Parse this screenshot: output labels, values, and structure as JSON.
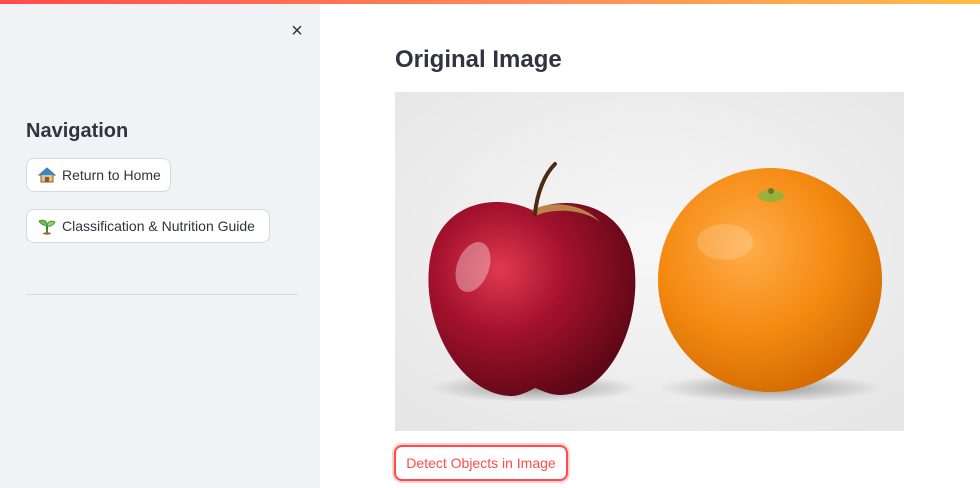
{
  "colors": {
    "accent": "#ff4b4b",
    "sidebar_bg": "#f0f2f6",
    "text": "#31333f"
  },
  "sidebar": {
    "close_label": "×",
    "heading": "Navigation",
    "buttons": [
      {
        "label": "Return to Home",
        "icon": "house-icon"
      },
      {
        "label": "Classification & Nutrition Guide",
        "icon": "seedling-icon"
      }
    ]
  },
  "main": {
    "title": "Original Image",
    "image": {
      "icon": "apple-orange-photo"
    },
    "detect_button_label": "Detect Objects in Image"
  }
}
